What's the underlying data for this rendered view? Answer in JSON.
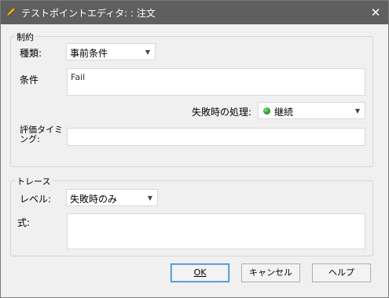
{
  "window": {
    "title": "テストポイントエディタ: : 注文",
    "title_icon": "pencil-icon",
    "close_glyph": "✕"
  },
  "constraints": {
    "legend": "制約",
    "type_label": "種類:",
    "type_value": "事前条件",
    "condition_label": "条件",
    "condition_value": "Fail",
    "fail_action_label": "失敗時の処理:",
    "fail_action_value": "継続",
    "fail_action_icon": "green-dot-icon",
    "eval_timing_label_line1": "評価タイミ",
    "eval_timing_label_line2": "ング:",
    "eval_timing_value": ""
  },
  "trace": {
    "legend": "トレース",
    "level_label": "レベル:",
    "level_value": "失敗時のみ",
    "expression_label": "式:",
    "expression_value": ""
  },
  "buttons": {
    "ok": "OK",
    "cancel": "キャンセル",
    "help": "ヘルプ"
  },
  "colors": {
    "titlebar": "#5f5f5f",
    "dialog_bg": "#f0f0f0",
    "default_button_border": "#2f7fd1"
  }
}
